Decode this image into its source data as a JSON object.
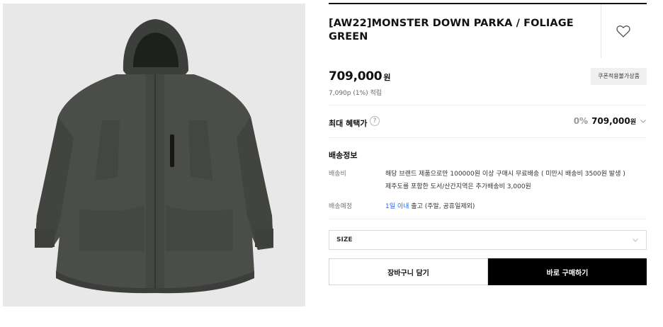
{
  "product": {
    "title": "[AW22]MONSTER DOWN PARKA / FOLIAGE GREEN",
    "image_alt": "jacket-photo",
    "price": "709,000",
    "price_unit": "원",
    "points": "7,090p (1%) 적립",
    "coupon_badge": "쿠폰적용불가상품",
    "wishlist_icon": "heart-outline-icon"
  },
  "benefit": {
    "label": "최대 혜택가",
    "help": "?",
    "percent": "0%",
    "amount": "709,000",
    "unit": "원"
  },
  "shipping": {
    "heading": "배송정보",
    "fee_label": "배송비",
    "fee_line1": "해당 브랜드 제품으로만 100000원 이상 구매시 무료배송 ( 미만시 배송비 3500원 발생 )",
    "fee_line2": "제주도를 포함한 도서/산간지역은 추가배송비 3,000원",
    "eta_label": "배송예정",
    "eta_highlight": "1일 이내",
    "eta_rest": " 출고 (주말, 공휴일제외)"
  },
  "options": {
    "size_label": "SIZE"
  },
  "actions": {
    "cart_label": "장바구니 담기",
    "buy_label": "바로 구매하기"
  }
}
